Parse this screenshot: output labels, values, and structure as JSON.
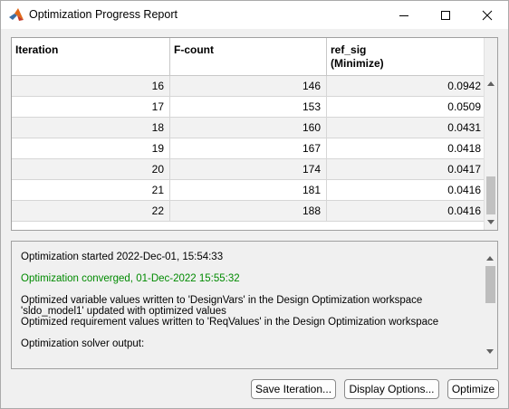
{
  "window": {
    "title": "Optimization Progress Report",
    "app_icon": "matlab-icon",
    "controls": [
      "minimize-icon",
      "maximize-icon",
      "close-icon"
    ]
  },
  "table": {
    "headers": [
      {
        "label": "Iteration",
        "sub": ""
      },
      {
        "label": "F-count",
        "sub": ""
      },
      {
        "label": "ref_sig",
        "sub": "(Minimize)"
      }
    ],
    "rows": [
      [
        "16",
        "146",
        "0.0942"
      ],
      [
        "17",
        "153",
        "0.0509"
      ],
      [
        "18",
        "160",
        "0.0431"
      ],
      [
        "19",
        "167",
        "0.0418"
      ],
      [
        "20",
        "174",
        "0.0417"
      ],
      [
        "21",
        "181",
        "0.0416"
      ],
      [
        "22",
        "188",
        "0.0416"
      ]
    ]
  },
  "log": {
    "started": "Optimization started 2022-Dec-01, 15:54:33",
    "converged": "Optimization converged, 01-Dec-2022 15:55:32",
    "written_vars": "Optimized variable values written to 'DesignVars' in the Design Optimization workspace",
    "model_updated": "'sldo_model1' updated with optimized values",
    "written_reqs": "Optimized requirement values written to 'ReqValues' in the Design Optimization workspace",
    "solver_output": "Optimization solver output:",
    "converged_color": "#008a00"
  },
  "buttons": {
    "save_iteration": "Save Iteration...",
    "display_options": "Display Options...",
    "optimize": "Optimize"
  }
}
